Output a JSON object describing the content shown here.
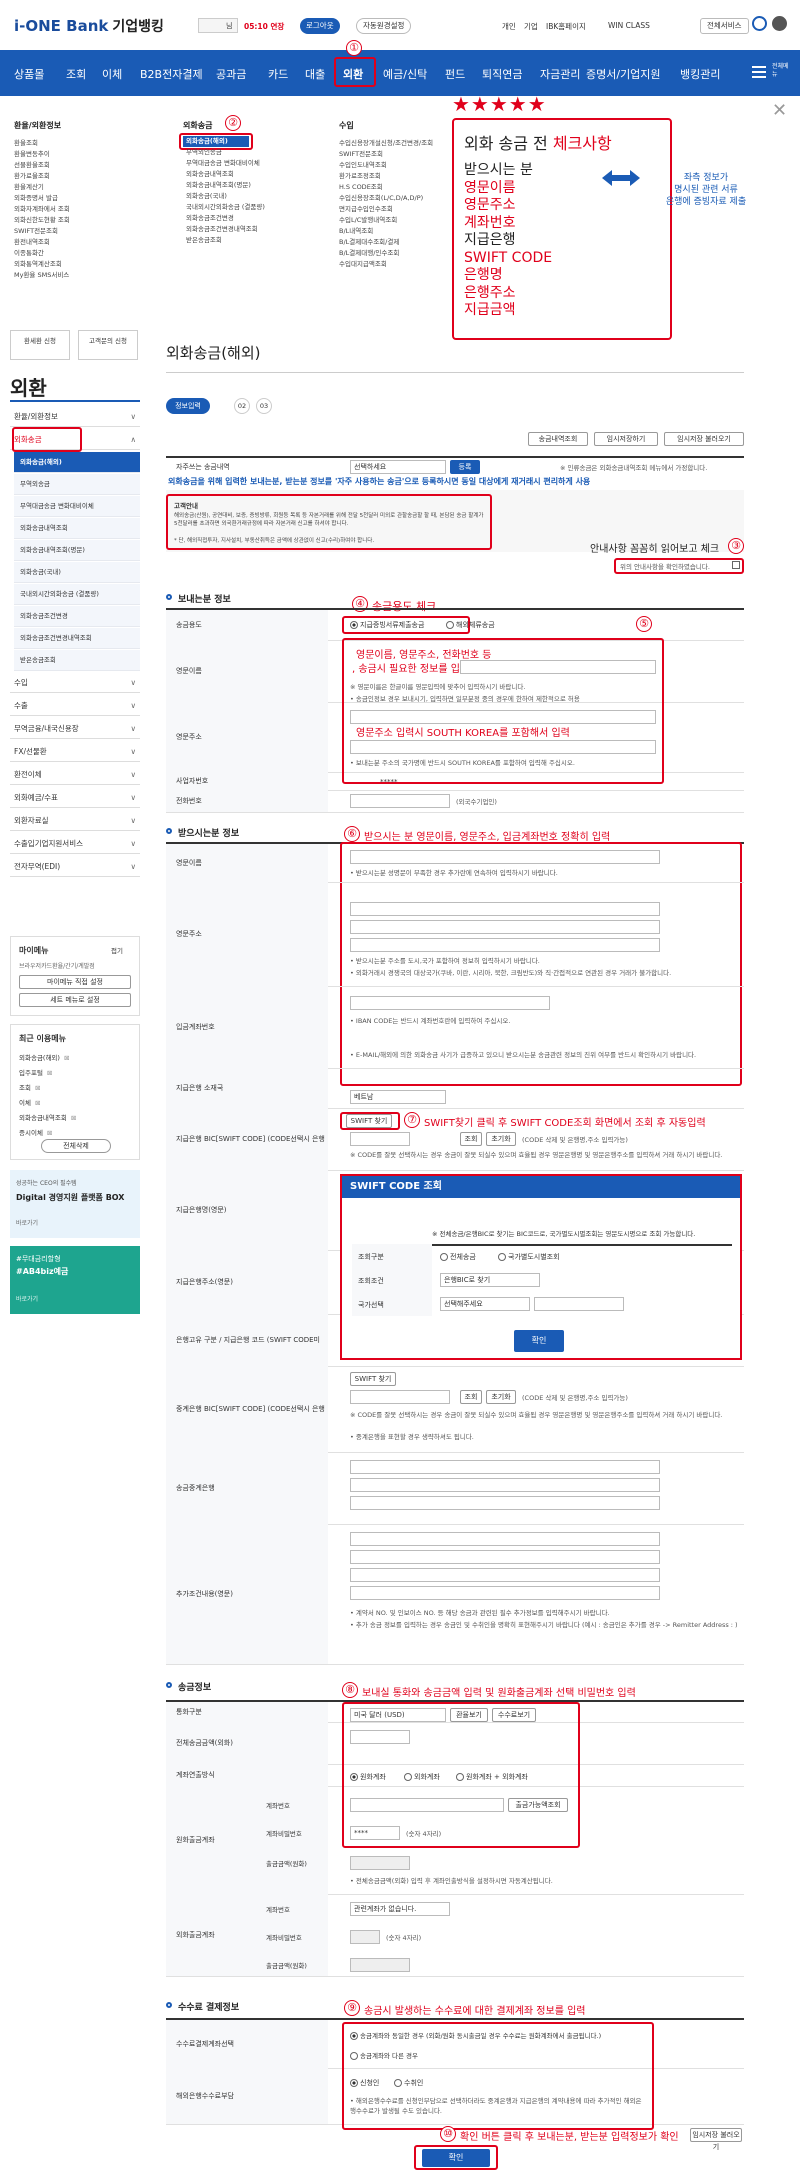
{
  "header": {
    "logo": "i-ONE Bank",
    "logo_sub": "기업뱅킹",
    "user_suffix": "님",
    "session": "05:10 연장",
    "logout": "로그아웃",
    "auto_logout": "자동원경설정",
    "links": [
      "개인",
      "기업",
      "IBK홈페이지",
      "WIN CLASS"
    ],
    "all_service": "전체서비스"
  },
  "nav": {
    "items": [
      "상품몰",
      "조회",
      "이체",
      "B2B전자결제",
      "공과금",
      "카드",
      "대출",
      "외환",
      "예금/신탁",
      "펀드",
      "퇴직연금",
      "자금관리",
      "증명서/기업지원",
      "뱅킹관리"
    ],
    "all_menu": "전체메뉴"
  },
  "megamenu": {
    "col1_title": "환율/외환정보",
    "col1": [
      "환율조회",
      "환율변동추이",
      "선물환율조회",
      "환가료율조회",
      "환율계산기",
      "외화증명서 발급",
      "외화자계좌에서 조회",
      "외화신한도현황 조회",
      "SWIFT전문조회",
      "환전내역조회",
      "이종통화간",
      "외화통역계산조회",
      "My환율 SMS서비스"
    ],
    "col2_title": "외화송금",
    "col2": [
      "외화송금(해외)",
      "무역외인송금",
      "무역대금송금 변화대비이체",
      "외화송금내역조회",
      "외화송금내역조회(명문)",
      "외화송금(국내)",
      "국내외시간외화송금 (결품량)",
      "외화송금조건변경",
      "외화송금조건변경내역조회",
      "받은송금조회"
    ],
    "col3_title": "수입",
    "col3": [
      "수입신용장개설신청/조건변경/조회",
      "SWIFT전문조회",
      "수입인도내역조회",
      "환가료조정조회",
      "H.S CODE조회",
      "수입신용장조회(L/C,D/A,D/P)",
      "면지급수입인수조회",
      "수입L/C발행내역조회",
      "B/L내역조회",
      "B/L결제대수조회/결제",
      "B/L결제대행/인수조회",
      "수입대지급액조회"
    ]
  },
  "checklist": {
    "stars": "★★★★★",
    "title_a": "외화 송금 전 ",
    "title_b": "체크사항",
    "items": [
      "받으시는 분",
      "영문이름",
      "영문주소",
      "계좌번호",
      "지급은행",
      "SWIFT CODE",
      "은행명",
      "은행주소",
      "지급금액"
    ],
    "side": [
      "좌측 정보가",
      "명시된 관련 서류",
      "은행에 증빙자료 제출"
    ]
  },
  "left": {
    "title": "외환",
    "quick": [
      "환세환 신청",
      "고객문의 신청"
    ],
    "menu": [
      "환율/외환정보",
      "외화송금",
      "수입",
      "수출",
      "무역금융/내국신용장",
      "FX/선물환",
      "환전이체",
      "외화예금/수표",
      "외환자료실",
      "수출입기업지원서비스",
      "전자무역(EDI)"
    ],
    "submenu": [
      "외화송금(해외)",
      "무역외송금",
      "무역대금송금 변화대비이체",
      "외화송금내역조회",
      "외화송금내역조회(명문)",
      "외화송금(국내)",
      "국내외시간외화송금 (결품량)",
      "외화송금조건변경",
      "외화송금조건변경내역조회",
      "받은송금조회"
    ],
    "my_title": "마이메뉴",
    "my_fold": "접기",
    "my_desc": "브라우저카드환율/간기/계발점",
    "my_btn1": "마이메뉴 직접 설정",
    "my_btn2": "세트 메뉴로 설정",
    "recent_title": "최근 이용메뉴",
    "recent": [
      "외화송금(해외)",
      "입주포털",
      "조회",
      "이체",
      "외화송금내역조회",
      "증시이체"
    ],
    "recent_btn": "전체삭제",
    "banner1_a": "성공하는 CEO의 필수템",
    "banner1_b": "Digital 경영지원 플랫폼 BOX",
    "banner1_c": "바로가기",
    "banner2_a": "#무대금리할형",
    "banner2_b": "#AB4biz예금",
    "banner2_c": "바로가기"
  },
  "page": {
    "title": "외화송금(해외)",
    "steps": [
      "정보입력",
      "02",
      "03"
    ],
    "tools": [
      "송금내역조회",
      "임시저장하기",
      "임시저장 불러오기"
    ],
    "fav_label": "자주쓰는 송금내역",
    "fav_select": "선택하세요",
    "fav_btn": "등록",
    "fav_note": "※ 인류송금은 외화송금내역조회 메뉴에서 가정합니다.",
    "fav_desc": "외화송금을 위해 입력한 보내는분, 받는분 정보를 '자주 사용하는 송금'으로 등록하시면 동일 대상에게 재거래시 편리하게 사용",
    "notice_title": "고객안내",
    "notice_body": "해외송금(산원), 공연대비, 보증, 증빙방류, 회원등 목록 등 자본거래를 위해 전달 5천달러 미외로 관할송금할 할 때, 본담된 송금 할계가 5천달러를 초과하면 외국환거래규정에 따라 자본거래 신고를 하셔야 합니다.",
    "notice_body2": "* 단, 해외직접투자, 지사설치, 부동산취득은 금액에 상관없이 신고(수리)하여야 합니다.",
    "confirm_text": "위의 안내사항을 확인하였습니다."
  },
  "annotations": {
    "a1": "①",
    "a2": "②",
    "a3": "③",
    "a4": "④",
    "a5": "⑤",
    "a6": "⑥",
    "a7": "⑦",
    "a8": "⑧",
    "a9": "⑨",
    "a10": "⑩",
    "t3": "안내사항 꼼꼼히 읽어보고 체크",
    "t4": "송금용도 체크",
    "t5_a": "영문이름, 영문주소, 전화번호 등",
    "t5_b": ", 송금시 필요한 정보를 입력",
    "t5_c": "영문주소 입력시 SOUTH KOREA를 포함해서 입력",
    "t6": "받으시는 분 영문이름, 영문주소, 입금계좌번호 정확히 입력",
    "t7": "SWIFT찾기 클릭 후 SWIFT CODE조회 화면에서 조회 후 자동입력",
    "t8": "보내실 통화와 송금금액 입력 및 원화출금계좌 선택 비밀번호 입력",
    "t9": "송금시 발생하는 수수료에 대한 결제계좌 정보를 입력",
    "t10": "확인 버튼 클릭 후 보내는분, 받는분 입력정보가 확인"
  },
  "sender": {
    "section": "보내는분 정보",
    "purpose_label": "송금용도",
    "purpose_opt1": "지급증빙서류제출송금",
    "purpose_opt2": "해외체류송금",
    "name_label": "영문이름",
    "name_note": "※ 영문이름은 한글이름 영문입력에 맞추어 입력하시기 바랍니다.",
    "name_note2": "• 송금인정보 경우 보내시기, 입력하면 일부분정 중의 경우에 한하여 제한적으로 허용",
    "addr_label": "영문주소",
    "addr_note": "• 보내는분 주소의 국가명에 반드시 SOUTH KOREA를 포함하여 입력해 주십시오.",
    "biz_label": "사업자번호",
    "biz_value": "*****",
    "tel_label": "전화번호",
    "tel_note": "(외국수기업인)"
  },
  "receiver": {
    "section": "받으시는분 정보",
    "name_label": "영문이름",
    "name_note": "• 받으시는분 성명문이 부족한 경우 추가란에 연속하여 입력하시기 바랍니다.",
    "addr_label": "영문주소",
    "addr_note": "• 받으시는분 주소를 도시,국가 포함하여 정보히 입력하시기 바랍니다.",
    "addr_note2": "• 외화거래시 경쟁국의 대상국가(쿠바, 이란, 시리아, 북한, 크림반도)와 직·간접적으로 연관된 경우 거래가 불가합니다.",
    "acct_label": "입금계좌번호",
    "acct_note": "• IBAN CODE는 반드시 계좌번호란에 입력하여 주십시오.",
    "acct_note2": "• E-MAIL/해외에 의한 외화송금 사기가 급증하고 있으니 받으시는분 송금관련 정보의 진위 여부를 반드시 확인하시기 바랍니다.",
    "country_label": "지급은행 소재국",
    "country_value": "베트남",
    "swift_label": "지급은행 BIC[SWIFT CODE] (CODE선택시 은행명,주소 입력불가)",
    "swift_btn": "SWIFT 찾기",
    "swift_btns": [
      "조회",
      "초기화"
    ],
    "swift_note": "(CODE 삭제 및 은행명,주소 입력가능)",
    "swift_warn": "※ CODE를 잘못 선택하시는 경우 송금이 잘못 되실수 있으며 효율됩 경우 영문은행명 및 영문은행주소를 입력하셔 거래 하시기 바랍니다.",
    "bankname_label": "지급은행명(영문)",
    "bankaddr_label": "지급은행주소(영문)",
    "code_label": "은행고유 구분 / 지급은행 코드 (SWIFT CODE미상)",
    "inter_label": "중계은행 BIC[SWIFT CODE] (CODE선택시 은행명,주소 입력불가)",
    "inter_btn": "SWIFT 찾기",
    "inter_btns": [
      "조회",
      "초기화"
    ],
    "inter_note": "(CODE 삭제 및 은행명,주소 입력가능)",
    "inter_warn": "※ CODE를 잘못 선택하시는 경우 송금이 잘못 되실수 있으며 효율됩 경우 영문은행명 및 영문은행주소를 입력하셔 거래 하시기 바랍니다.",
    "inter_note2": "• 중계은행을 표현할 경우 생략하셔도 됩니다.",
    "intbank_label": "송금중계은행",
    "extra_label": "추가조건내용(영문)",
    "extra_note": "• 계약서 NO. 및 인보이스 NO. 등 해당 송금과 관련된 필수 추가정보를 입력해주시기 바랍니다.",
    "extra_note2": "• 추가 송금 정보를 입력하는 경우 송금인 및 수취인을 명확히 표현해주시기 바랍니다 (예시 : 송금인은 추가를 경우 -> Remitter Address : )"
  },
  "swift_popup": {
    "title": "SWIFT CODE 조회",
    "desc": "※ 전체송금/은행BIC로 찾기는 BIC코드로, 국가별도시별조회는 영문도시명으로 조회 가능합니다.",
    "type_label": "조회구분",
    "type_opt1": "전체송금",
    "type_opt2": "국가별도시별조회",
    "cond_label": "조회조건",
    "cond_value": "은행BIC로 찾기",
    "country_label": "국가선택",
    "country_value": "선택해주세요",
    "ok": "확인"
  },
  "transfer": {
    "section": "송금정보",
    "currency_label": "통화구분",
    "currency_value": "미국 달러 (USD)",
    "rate_btn": "환율보기",
    "fee_btn": "수수료보기",
    "amount_label": "전체송금금액(외화)",
    "method_label": "계좌연출방식",
    "method_opts": [
      "원화계좌",
      "외화계좌",
      "원화계좌 + 외화계좌"
    ],
    "krw_label": "원화출금계좌",
    "acct_label": "계좌번호",
    "balance_btn": "출금가능액조회",
    "pw_label": "계좌비밀번호",
    "pw_value": "****",
    "pw_note": "(숫자 4자리)",
    "amt_label": "출금금액(원화)",
    "amt_note": "• 전체송금금액(외화) 입력 후 계좌인출방식을 설정하시면 자동계산됩니다.",
    "fx_label": "외화출금계좌",
    "fx_acct_value": "관련계좌가 없습니다.",
    "fx_pw_note": "(숫자 4자리)"
  },
  "fee": {
    "section": "수수료 결제정보",
    "acct_label": "수수료결제계좌선택",
    "opt1": "송금계좌와 동일한 경우 (외화/원화 동시출금일 경우 수수료는 원화계좌에서 출금됩니다.)",
    "opt2": "송금계좌와 다른 경우",
    "bear_label": "해외은행수수료부담",
    "bear_opt1": "신청인",
    "bear_opt2": "수취인",
    "bear_note": "• 해외은행수수료를 신청인부담으로 선택하더라도 중계은행과 지급은행의 계약내용에 따라 추가적인 해외은행수수료가 발생될 수도 있습니다.",
    "bottom_tool": "임시저장 불러오기",
    "confirm": "확인"
  }
}
